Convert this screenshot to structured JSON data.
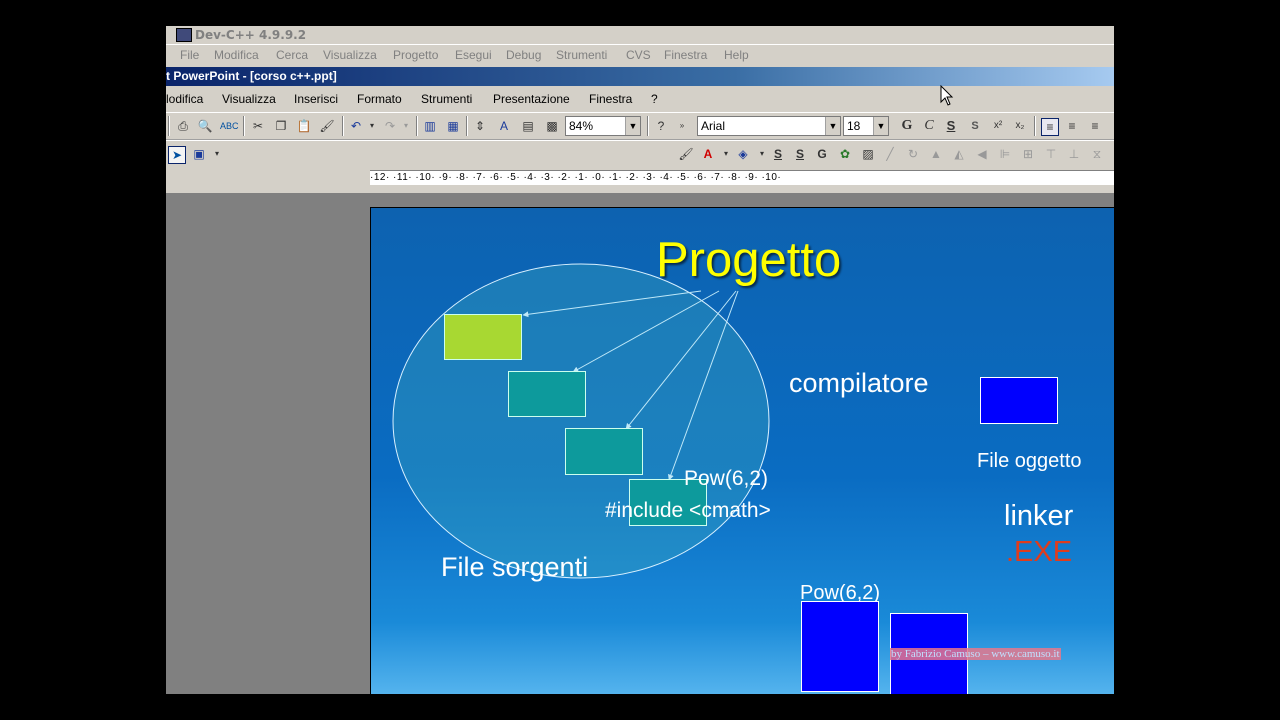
{
  "devcpp": {
    "title": "Dev-C++ 4.9.9.2",
    "menu": [
      "File",
      "Modifica",
      "Cerca",
      "Visualizza",
      "Progetto",
      "Esegui",
      "Debug",
      "Strumenti",
      "CVS",
      "Finestra",
      "Help"
    ]
  },
  "powerpoint": {
    "title": "t PowerPoint - [corso c++.ppt]",
    "menu": [
      "lodifica",
      "Visualizza",
      "Inserisci",
      "Formato",
      "Strumenti",
      "Presentazione",
      "Finestra",
      "?"
    ],
    "zoom": "84%",
    "font_name": "Arial",
    "font_size": "18",
    "format_buttons": [
      "G",
      "C",
      "S",
      "S",
      "x²",
      "x₂"
    ],
    "ruler": "·12·  ·11·  ·10·  ·9·  ·8·  ·7·  ·6·  ·5·  ·4·  ·3·  ·2·  ·1·  ·0·  ·1·  ·2·  ·3·  ·4·  ·5·  ·6·  ·7·  ·8·  ·9·  ·10·"
  },
  "slide": {
    "title": "Progetto",
    "compiler_label": "compilatore",
    "object_file_label": "File oggetto",
    "linker_label": "linker",
    "exe_label": ".EXE",
    "pow_label_1": "Pow(6,2)",
    "include_label": "#include <cmath>",
    "source_files_label": "File sorgenti",
    "pow_label_2": "Pow(6,2)",
    "watermark": "by Fabrizio Camuso – www.camuso.it",
    "colors": {
      "title": "#ffff00",
      "exe": "#e03c1c",
      "green_box": "#a8d832",
      "teal_box": "#0d9a9c",
      "blue_box": "#0000ff"
    }
  }
}
